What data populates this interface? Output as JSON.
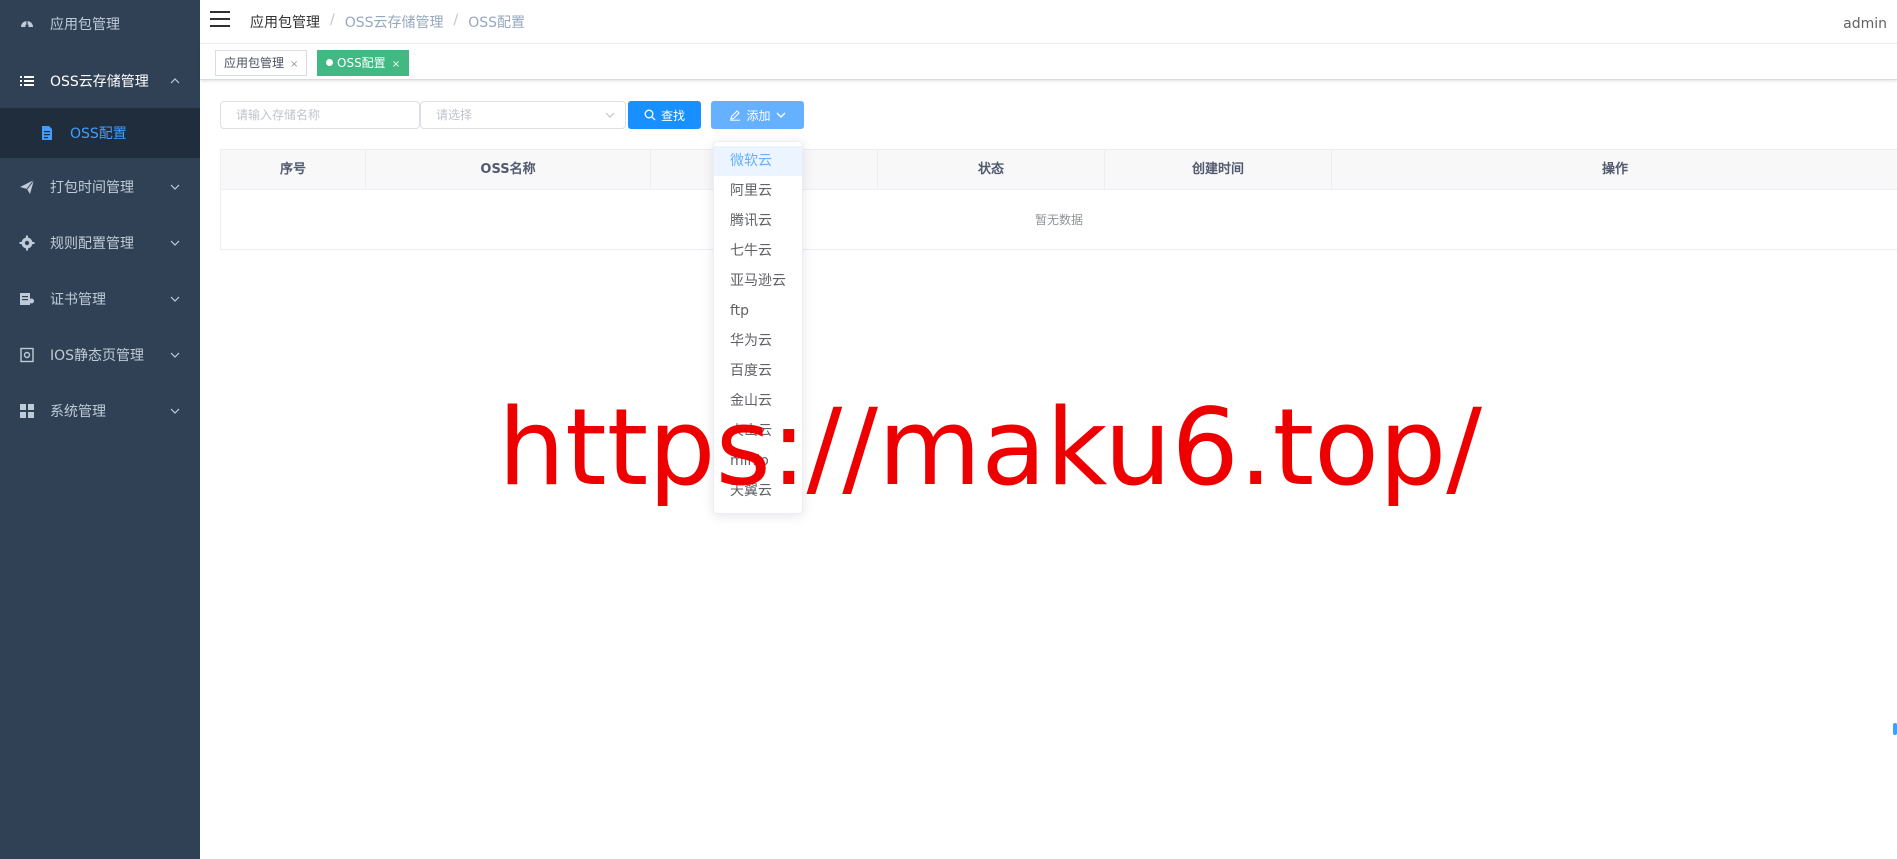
{
  "sidebar": {
    "items": [
      {
        "label": "应用包管理",
        "icon": "dashboard-icon"
      },
      {
        "label": "OSS云存储管理",
        "icon": "list-icon",
        "expanded": true
      },
      {
        "label": "打包时间管理",
        "icon": "send-icon"
      },
      {
        "label": "规则配置管理",
        "icon": "gear-icon"
      },
      {
        "label": "证书管理",
        "icon": "certificate-icon"
      },
      {
        "label": "IOS静态页管理",
        "icon": "page-icon"
      },
      {
        "label": "系统管理",
        "icon": "grid-icon"
      }
    ],
    "subitem": {
      "label": "OSS配置",
      "icon": "document-icon"
    }
  },
  "navbar": {
    "breadcrumb": [
      "应用包管理",
      "OSS云存储管理",
      "OSS配置"
    ],
    "separator": "/",
    "user": "admin"
  },
  "tags": [
    {
      "label": "应用包管理",
      "close": "×"
    },
    {
      "label": "OSS配置",
      "close": "×",
      "active": true
    }
  ],
  "filters": {
    "name_placeholder": "请输入存储名称",
    "select_placeholder": "请选择",
    "search_label": "查找",
    "add_label": "添加"
  },
  "table": {
    "columns": [
      "序号",
      "OSS名称",
      "",
      "状态",
      "创建时间",
      "操作"
    ],
    "empty_text": "暂无数据"
  },
  "dropdown": {
    "items": [
      "微软云",
      "阿里云",
      "腾讯云",
      "七牛云",
      "亚马逊云",
      "ftp",
      "华为云",
      "百度云",
      "金山云",
      "火山云",
      "minio",
      "天翼云"
    ]
  },
  "watermark": "https://maku6.top/",
  "colors": {
    "sidebar_bg": "#304156",
    "submenu_bg": "#1f2d3d",
    "active_text": "#409eff",
    "tag_active": "#42b983",
    "primary_button": "#1890ff",
    "watermark": "#ee0000"
  }
}
